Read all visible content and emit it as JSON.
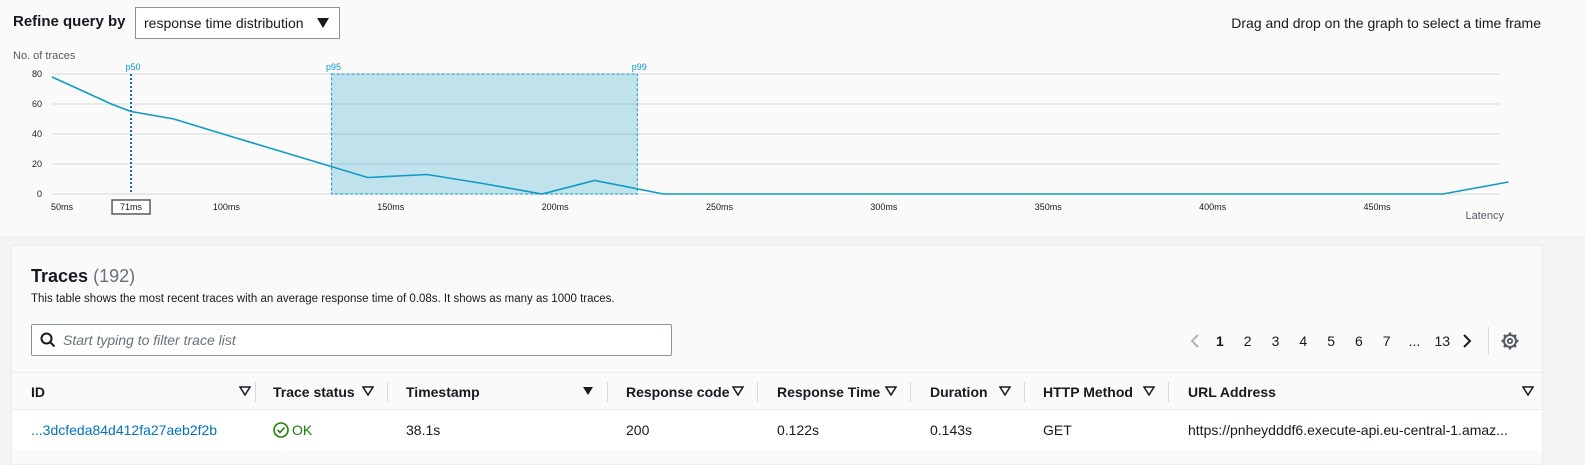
{
  "refine": {
    "label": "Refine query by",
    "selected": "response time distribution",
    "hint": "Drag and drop on the graph to select a time frame"
  },
  "chart_data": {
    "type": "line",
    "ylabel": "No. of traces",
    "xlabel": "Latency",
    "y_ticks": [
      "80",
      "60",
      "40",
      "20",
      "0"
    ],
    "x_ticks": [
      "50ms",
      "71ms",
      "100ms",
      "150ms",
      "200ms",
      "250ms",
      "300ms",
      "350ms",
      "400ms",
      "450ms"
    ],
    "markers": [
      {
        "label": "p50",
        "x_ms": 71
      },
      {
        "label": "p95",
        "x_ms": 132
      },
      {
        "label": "p99",
        "x_ms": 225
      }
    ],
    "selection_ms": [
      132,
      225
    ],
    "series": [
      {
        "x": [
          47,
          65,
          71,
          84,
          102,
          143,
          161,
          178,
          196,
          212,
          233,
          268,
          300,
          350,
          400,
          450,
          470,
          490
        ],
        "y": [
          78,
          60,
          55,
          50,
          38,
          11,
          13,
          7,
          0,
          9,
          0,
          0,
          0,
          0,
          0,
          0,
          0,
          8
        ]
      }
    ],
    "ylim": [
      0,
      80
    ],
    "xlim": [
      47,
      490
    ],
    "color": "#0f9ac7"
  },
  "traces": {
    "title": "Traces",
    "count": "(192)",
    "description": "This table shows the most recent traces with an average response time of 0.08s. It shows as many as 1000 traces.",
    "filter_placeholder": "Start typing to filter trace list",
    "pages": [
      "1",
      "2",
      "3",
      "4",
      "5",
      "6",
      "7",
      "...",
      "13"
    ],
    "columns": [
      "ID",
      "Trace status",
      "Timestamp",
      "Response code",
      "Response Time",
      "Duration",
      "HTTP Method",
      "URL Address"
    ],
    "rows": [
      {
        "id": "...3dcfeda84d412fa27aeb2f2b",
        "status": "OK",
        "timestamp": "38.1s",
        "response_code": "200",
        "response_time": "0.122s",
        "duration": "0.143s",
        "method": "GET",
        "url": "https://pnheydddf6.execute-api.eu-central-1.amaz..."
      }
    ]
  }
}
